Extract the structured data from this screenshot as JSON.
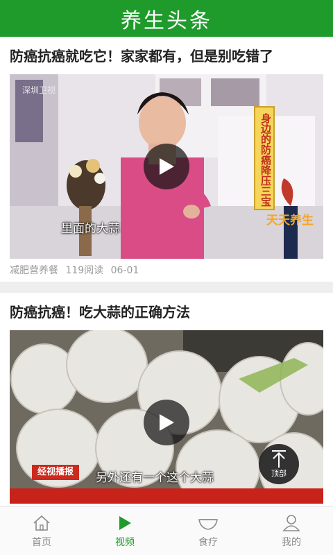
{
  "app": {
    "title": "养生头条"
  },
  "colors": {
    "brand": "#1f9b2c",
    "tab_inactive": "#8a8a8a"
  },
  "feed": {
    "items": [
      {
        "title": "防癌抗癌就吃它！家家都有，但是别吃错了",
        "category": "减肥营养餐",
        "reads": "119阅读",
        "date": "06-01",
        "overlay": {
          "channel": "深圳卫视",
          "subtitle": "里面的大蒜",
          "banner": "身边的防癌降压三宝",
          "brand": "天天养生"
        }
      },
      {
        "title": "防癌抗癌！吃大蒜的正确方法",
        "overlay": {
          "subtitle": "另外还有一个这个大蒜",
          "news_logo": "经视播报"
        }
      }
    ]
  },
  "back_to_top": {
    "label": "顶部",
    "icon": "arrow-up-icon"
  },
  "tabs": [
    {
      "label": "首页",
      "icon": "home-icon",
      "active": false
    },
    {
      "label": "视频",
      "icon": "play-icon",
      "active": true
    },
    {
      "label": "食疗",
      "icon": "bowl-icon",
      "active": false
    },
    {
      "label": "我的",
      "icon": "user-icon",
      "active": false
    }
  ]
}
